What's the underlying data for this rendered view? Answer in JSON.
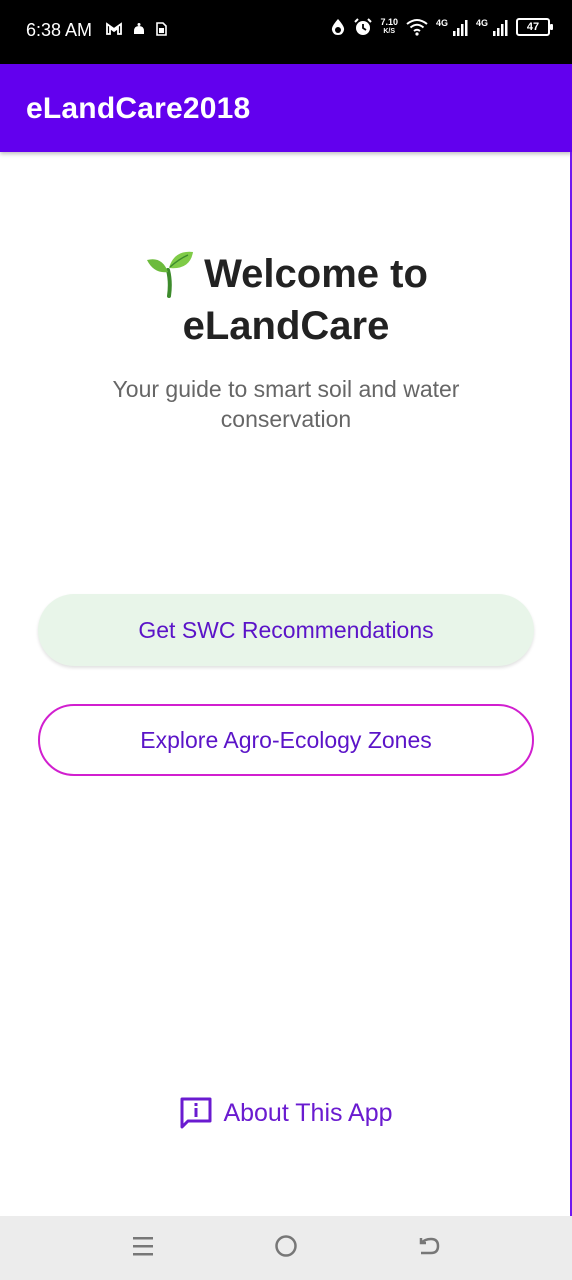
{
  "status_bar": {
    "time": "6:38 AM",
    "speed_value": "7.10",
    "speed_unit": "K/S",
    "network_1": "4G",
    "network_2": "4G",
    "battery": "47",
    "icons": [
      "gmail-icon",
      "notification-icon",
      "sim-icon",
      "data-saver-icon",
      "alarm-icon",
      "wifi-icon",
      "signal-icon",
      "signal-icon",
      "battery-icon"
    ]
  },
  "app_bar": {
    "title": "eLandCare2018",
    "color": "#6200ee"
  },
  "welcome": {
    "title_icon": "sprout-icon",
    "title": "Welcome to eLandCare",
    "subtitle": "Your guide to smart soil and water conservation"
  },
  "buttons": {
    "swc_label": "Get SWC Recommendations",
    "aez_label": "Explore Agro-Ecology Zones"
  },
  "about": {
    "icon": "info-message-icon",
    "label": "About This App"
  },
  "nav_bar": {
    "items": [
      "menu-icon",
      "home-icon",
      "back-icon"
    ]
  }
}
